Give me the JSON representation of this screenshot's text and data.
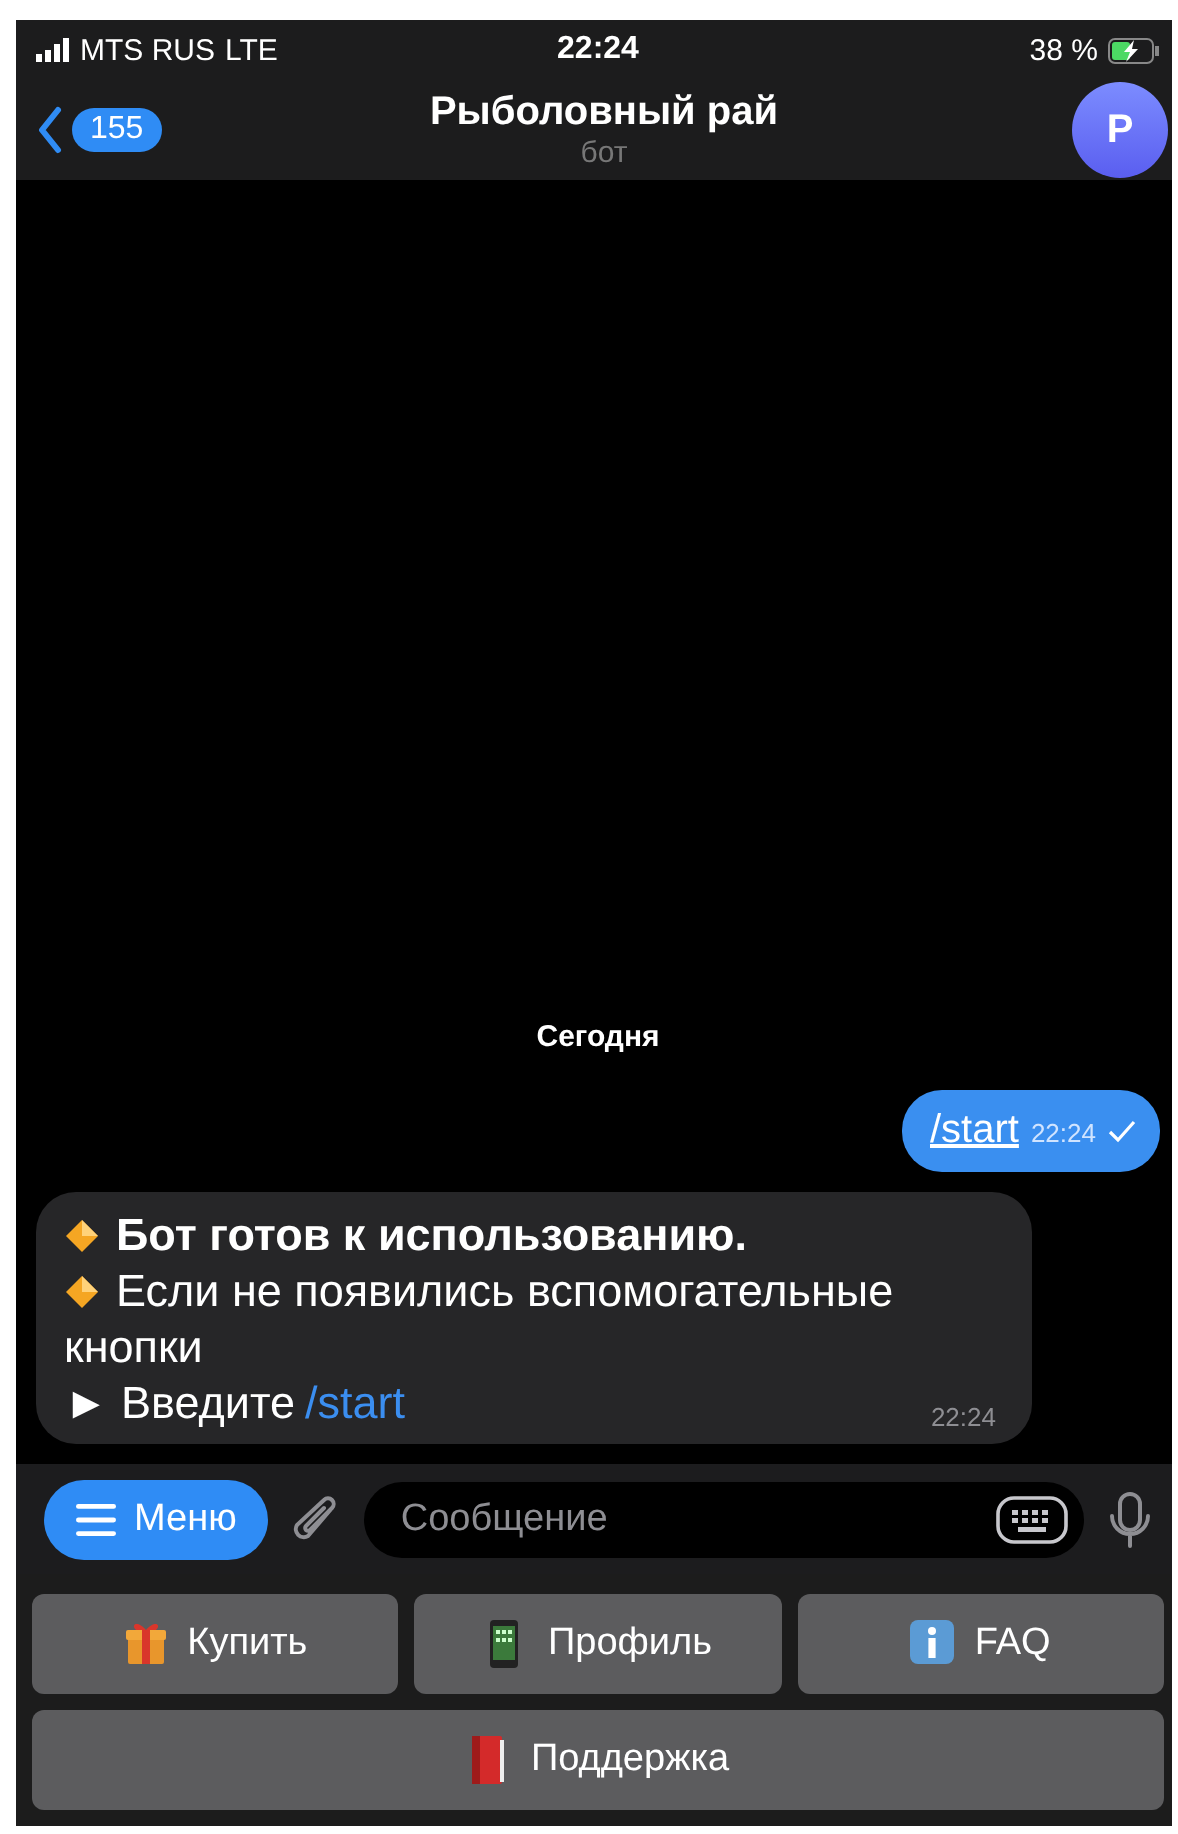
{
  "status_bar": {
    "carrier": "MTS RUS",
    "network": "LTE",
    "time": "22:24",
    "battery": "38 %",
    "charging": true
  },
  "header": {
    "back_count": "155",
    "title": "Рыболовный рай",
    "subtitle": "бот",
    "avatar_letter": "Р"
  },
  "date_chip": "Сегодня",
  "messages": [
    {
      "kind": "outgoing",
      "command": "/start",
      "time": "22:24"
    },
    {
      "kind": "incoming",
      "time": "22:24",
      "lines": [
        {
          "kind": "diamond",
          "text": "Бот готов к использованию.",
          "bold": true
        },
        {
          "kind": "diamond",
          "text": "Если не появились вспомогательные",
          "bold": false
        },
        {
          "kind": "plain",
          "text": "кнопки",
          "bold": false
        },
        {
          "kind": "arrow",
          "marker": "►",
          "text": "Введите",
          "command": "/start",
          "bold": false
        }
      ]
    }
  ],
  "composer": {
    "menu_label": "Меню",
    "placeholder": "Сообщение"
  },
  "keyboard_rows": [
    [
      {
        "kind": "gift",
        "label": "Купить"
      },
      {
        "kind": "phone",
        "label": "Профиль"
      },
      {
        "kind": "info",
        "label": "FAQ"
      }
    ],
    [
      {
        "kind": "book",
        "label": "Поддержка"
      }
    ]
  ]
}
